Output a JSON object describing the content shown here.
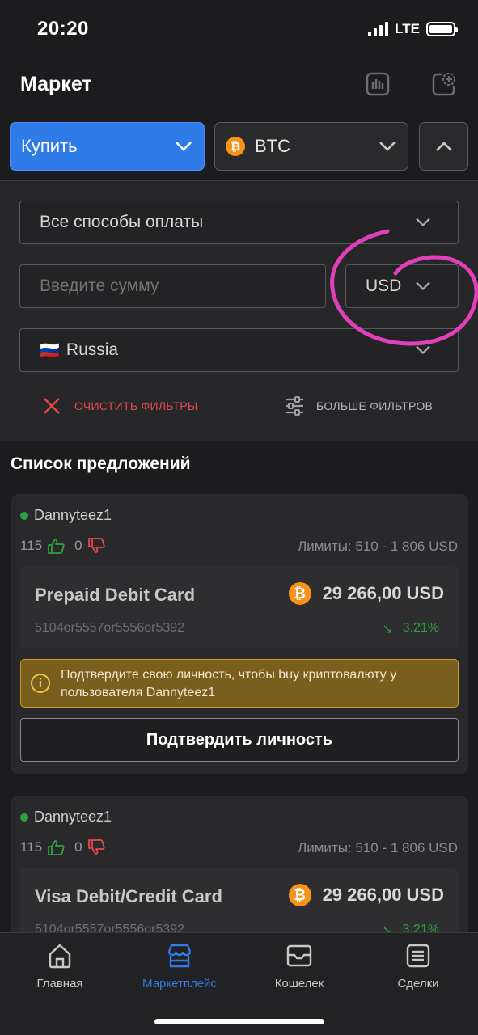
{
  "status_bar": {
    "time": "20:20",
    "network": "LTE"
  },
  "header": {
    "title": "Маркет",
    "icons": [
      "chart-icon",
      "add-ad-icon"
    ]
  },
  "top_controls": {
    "action_select": "Купить",
    "currency_select": "BTC",
    "collapse_icon": "chevron-up-icon",
    "accent_color": "#2f7be8"
  },
  "filters": {
    "payment_method": "Все способы оплаты",
    "amount_placeholder": "Введите сумму",
    "fiat_currency": "USD",
    "country_flag": "🇷🇺",
    "country": "Russia",
    "clear_label": "ОЧИСТИТЬ ФИЛЬТРЫ",
    "more_label": "БОЛЬШЕ ФИЛЬТРОВ"
  },
  "offers_title": "Список предложений",
  "offers": [
    {
      "user": "Dannyteez1",
      "likes": "115",
      "dislikes": "0",
      "limits": "Лимиты: 510 - 1 806 USD",
      "method": "Prepaid Debit Card",
      "price": "29 266,00 USD",
      "details": "5104or5557or5556or5392",
      "change": "3.21%",
      "alert": "Подтвердите свою личность, чтобы buy криптовалюту у пользователя Dannyteez1",
      "button": "Подтвердить личность"
    },
    {
      "user": "Dannyteez1",
      "likes": "115",
      "dislikes": "0",
      "limits": "Лимиты: 510 - 1 806 USD",
      "method": "Visa Debit/Credit Card",
      "price": "29 266,00 USD",
      "details": "5104or5557or5556or5392",
      "change": "3.21%"
    }
  ],
  "tab_bar": {
    "items": [
      {
        "label": "Главная",
        "icon": "home-icon"
      },
      {
        "label": "Маркетплейс",
        "icon": "store-icon",
        "active": true
      },
      {
        "label": "Кошелек",
        "icon": "wallet-icon"
      },
      {
        "label": "Сделки",
        "icon": "deals-icon"
      }
    ]
  }
}
